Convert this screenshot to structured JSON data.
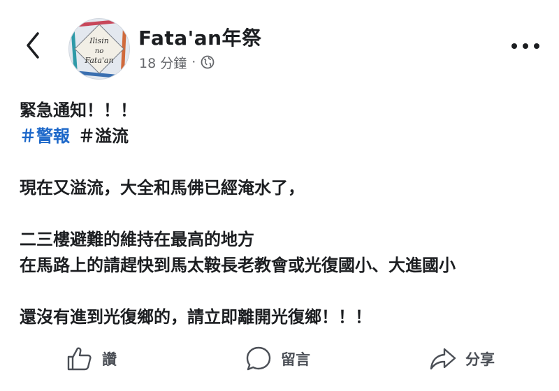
{
  "header": {
    "page_name": "Fata'an年祭",
    "timestamp": "18 分鐘",
    "separator": "·",
    "avatar_text": [
      "Ilisin",
      "no",
      "Fata'an"
    ]
  },
  "post": {
    "line1": "緊急通知！！！",
    "hashtags": [
      "＃警報",
      "＃溢流"
    ],
    "line3": "現在又溢流，大全和馬佛已經淹水了，",
    "line5": "二三樓避難的維持在最高的地方",
    "line6": "在馬路上的請趕快到馬太鞍長老教會或光復國小、大進國小",
    "line8": "還沒有進到光復鄉的，請立即離開光復鄉！！！"
  },
  "actions": {
    "like": "讚",
    "comment": "留言",
    "share": "分享"
  },
  "colors": {
    "hashtag": "#1d68c9",
    "meta": "#65676b",
    "text": "#1c1e21"
  }
}
